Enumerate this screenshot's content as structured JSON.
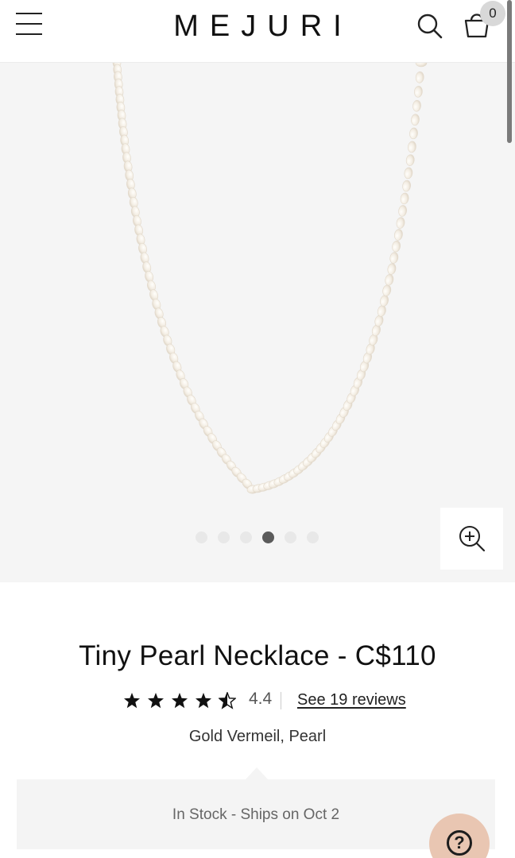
{
  "header": {
    "logo": "MEJURI",
    "cart_count": "0"
  },
  "gallery": {
    "image_count": 6,
    "active_index": 3
  },
  "product": {
    "title": "Tiny Pearl Necklace - C$110",
    "rating_value": "4.4",
    "rating_stars": 4.5,
    "reviews_link": "See 19 reviews",
    "material": "Gold Vermeil, Pearl",
    "stock_status": "In Stock - Ships on Oct 2"
  },
  "help": {
    "icon_glyph": "?"
  },
  "colors": {
    "accent_help": "#e9c6b2",
    "gallery_bg": "#f5f5f5"
  },
  "icons": [
    "menu-icon",
    "search-icon",
    "cart-icon",
    "zoom-in-icon",
    "star-icon",
    "help-icon"
  ]
}
